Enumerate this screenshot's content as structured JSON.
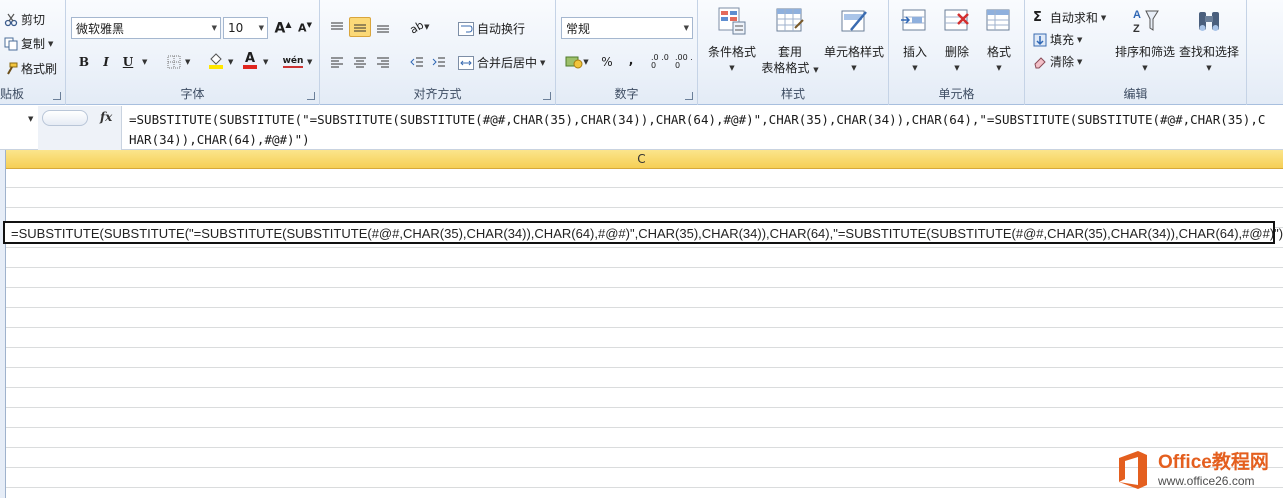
{
  "clipboard": {
    "cut": "剪切",
    "copy": "复制",
    "format_painter": "格式刷",
    "label": "贴板"
  },
  "font": {
    "name": "微软雅黑",
    "size": "10",
    "bold": "B",
    "italic": "I",
    "underline": "U",
    "font_color_glyph": "A",
    "pinyin_glyph": "wén",
    "label": "字体"
  },
  "alignment": {
    "wrap_text": "自动换行",
    "merge_center": "合并后居中",
    "label": "对齐方式"
  },
  "number": {
    "format": "常规",
    "percent": "%",
    "comma": ",",
    "inc_decimal": ".0 .00",
    "dec_decimal": ".00 .0",
    "label": "数字"
  },
  "styles": {
    "conditional": "条件格式",
    "table_line1": "套用",
    "table_line2": "表格格式",
    "cell_styles": "单元格样式",
    "label": "样式"
  },
  "cells": {
    "insert": "插入",
    "delete": "删除",
    "format": "格式",
    "label": "单元格"
  },
  "editing": {
    "autosum": "自动求和",
    "fill": "填充",
    "clear": "清除",
    "sort_filter": "排序和筛选",
    "find_select": "查找和选择",
    "label": "编辑"
  },
  "formula_bar": {
    "fx": "fx",
    "formula": "=SUBSTITUTE(SUBSTITUTE(\"=SUBSTITUTE(SUBSTITUTE(#@#,CHAR(35),CHAR(34)),CHAR(64),#@#)\",CHAR(35),CHAR(34)),CHAR(64),\"=SUBSTITUTE(SUBSTITUTE(#@#,CHAR(35),CHAR(34)),CHAR(64),#@#)\")"
  },
  "sheet": {
    "column_letter": "C",
    "active_cell_text": "=SUBSTITUTE(SUBSTITUTE(\"=SUBSTITUTE(SUBSTITUTE(#@#,CHAR(35),CHAR(34)),CHAR(64),#@#)\",CHAR(35),CHAR(34)),CHAR(64),\"=SUBSTITUTE(SUBSTITUTE(#@#,CHAR(35),CHAR(34)),CHAR(64),#@#)\")"
  },
  "watermark": {
    "title": "Office教程网",
    "url": "www.office26.com"
  },
  "colors": {
    "header_highlight": "#f6cf55",
    "font_color_bar": "#e0261e",
    "highlight_bar": "#ffe600",
    "watermark": "#e45f1f"
  }
}
